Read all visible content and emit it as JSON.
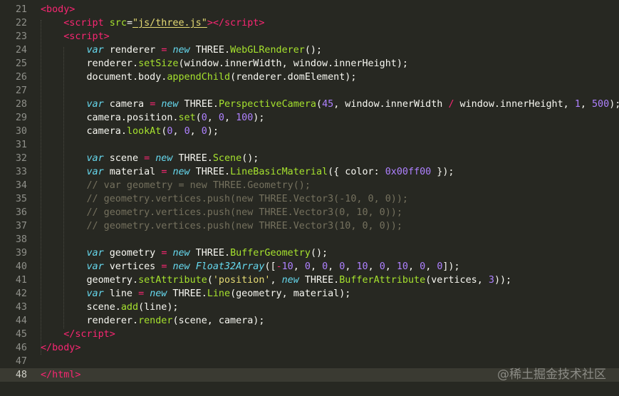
{
  "editor": {
    "theme": "Monokai",
    "colors": {
      "background": "#272822",
      "current_line": "#3a3a32",
      "line_number": "#8f908a",
      "tag": "#f92672",
      "attribute": "#a6e22e",
      "string": "#e6db74",
      "keyword": "#66d9ef",
      "number": "#ae81ff",
      "comment": "#75715e",
      "text": "#f8f8f2"
    },
    "current_line_number": 48,
    "lines": [
      {
        "n": 21,
        "tokens": [
          [
            "tag",
            "<body>"
          ]
        ]
      },
      {
        "n": 22,
        "tokens": [
          [
            "text",
            "    "
          ],
          [
            "tag",
            "<script "
          ],
          [
            "attr",
            "src"
          ],
          [
            "text",
            "="
          ],
          [
            "str",
            "\"js/three.js\""
          ],
          [
            "tag",
            "></"
          ],
          [
            "tag",
            "script"
          ],
          [
            "tag",
            ">"
          ]
        ]
      },
      {
        "n": 23,
        "tokens": [
          [
            "text",
            "    "
          ],
          [
            "tag",
            "<script>"
          ]
        ]
      },
      {
        "n": 24,
        "tokens": [
          [
            "text",
            "        "
          ],
          [
            "kw",
            "var"
          ],
          [
            "text",
            " renderer "
          ],
          [
            "op",
            "="
          ],
          [
            "text",
            " "
          ],
          [
            "kw",
            "new"
          ],
          [
            "text",
            " THREE."
          ],
          [
            "fn",
            "WebGLRenderer"
          ],
          [
            "text",
            "();"
          ]
        ]
      },
      {
        "n": 25,
        "tokens": [
          [
            "text",
            "        renderer."
          ],
          [
            "fn",
            "setSize"
          ],
          [
            "text",
            "(window.innerWidth, window.innerHeight);"
          ]
        ]
      },
      {
        "n": 26,
        "tokens": [
          [
            "text",
            "        document.body."
          ],
          [
            "fn",
            "appendChild"
          ],
          [
            "text",
            "(renderer.domElement);"
          ]
        ]
      },
      {
        "n": 27,
        "tokens": []
      },
      {
        "n": 28,
        "tokens": [
          [
            "text",
            "        "
          ],
          [
            "kw",
            "var"
          ],
          [
            "text",
            " camera "
          ],
          [
            "op",
            "="
          ],
          [
            "text",
            " "
          ],
          [
            "kw",
            "new"
          ],
          [
            "text",
            " THREE."
          ],
          [
            "fn",
            "PerspectiveCamera"
          ],
          [
            "text",
            "("
          ],
          [
            "num",
            "45"
          ],
          [
            "text",
            ", window.innerWidth "
          ],
          [
            "op",
            "/"
          ],
          [
            "text",
            " window.innerHeight, "
          ],
          [
            "num",
            "1"
          ],
          [
            "text",
            ", "
          ],
          [
            "num",
            "500"
          ],
          [
            "text",
            ");"
          ]
        ]
      },
      {
        "n": 29,
        "tokens": [
          [
            "text",
            "        camera.position."
          ],
          [
            "fn",
            "set"
          ],
          [
            "text",
            "("
          ],
          [
            "num",
            "0"
          ],
          [
            "text",
            ", "
          ],
          [
            "num",
            "0"
          ],
          [
            "text",
            ", "
          ],
          [
            "num",
            "100"
          ],
          [
            "text",
            ");"
          ]
        ]
      },
      {
        "n": 30,
        "tokens": [
          [
            "text",
            "        camera."
          ],
          [
            "fn",
            "lookAt"
          ],
          [
            "text",
            "("
          ],
          [
            "num",
            "0"
          ],
          [
            "text",
            ", "
          ],
          [
            "num",
            "0"
          ],
          [
            "text",
            ", "
          ],
          [
            "num",
            "0"
          ],
          [
            "text",
            ");"
          ]
        ]
      },
      {
        "n": 31,
        "tokens": []
      },
      {
        "n": 32,
        "tokens": [
          [
            "text",
            "        "
          ],
          [
            "kw",
            "var"
          ],
          [
            "text",
            " scene "
          ],
          [
            "op",
            "="
          ],
          [
            "text",
            " "
          ],
          [
            "kw",
            "new"
          ],
          [
            "text",
            " THREE."
          ],
          [
            "fn",
            "Scene"
          ],
          [
            "text",
            "();"
          ]
        ]
      },
      {
        "n": 33,
        "tokens": [
          [
            "text",
            "        "
          ],
          [
            "kw",
            "var"
          ],
          [
            "text",
            " material "
          ],
          [
            "op",
            "="
          ],
          [
            "text",
            " "
          ],
          [
            "kw",
            "new"
          ],
          [
            "text",
            " THREE."
          ],
          [
            "fn",
            "LineBasicMaterial"
          ],
          [
            "text",
            "({ color: "
          ],
          [
            "num",
            "0x00ff00"
          ],
          [
            "text",
            " });"
          ]
        ]
      },
      {
        "n": 34,
        "tokens": [
          [
            "text",
            "        "
          ],
          [
            "cmt",
            "// var geometry = new THREE.Geometry();"
          ]
        ]
      },
      {
        "n": 35,
        "tokens": [
          [
            "text",
            "        "
          ],
          [
            "cmt",
            "// geometry.vertices.push(new THREE.Vector3(-10, 0, 0));"
          ]
        ]
      },
      {
        "n": 36,
        "tokens": [
          [
            "text",
            "        "
          ],
          [
            "cmt",
            "// geometry.vertices.push(new THREE.Vector3(0, 10, 0));"
          ]
        ]
      },
      {
        "n": 37,
        "tokens": [
          [
            "text",
            "        "
          ],
          [
            "cmt",
            "// geometry.vertices.push(new THREE.Vector3(10, 0, 0));"
          ]
        ]
      },
      {
        "n": 38,
        "tokens": []
      },
      {
        "n": 39,
        "tokens": [
          [
            "text",
            "        "
          ],
          [
            "kw",
            "var"
          ],
          [
            "text",
            " geometry "
          ],
          [
            "op",
            "="
          ],
          [
            "text",
            " "
          ],
          [
            "kw",
            "new"
          ],
          [
            "text",
            " THREE."
          ],
          [
            "fn",
            "BufferGeometry"
          ],
          [
            "text",
            "();"
          ]
        ]
      },
      {
        "n": 40,
        "tokens": [
          [
            "text",
            "        "
          ],
          [
            "kw",
            "var"
          ],
          [
            "text",
            " vertices "
          ],
          [
            "op",
            "="
          ],
          [
            "text",
            " "
          ],
          [
            "kw",
            "new"
          ],
          [
            "text",
            " "
          ],
          [
            "type",
            "Float32Array"
          ],
          [
            "text",
            "(["
          ],
          [
            "op",
            "-"
          ],
          [
            "num",
            "10"
          ],
          [
            "text",
            ", "
          ],
          [
            "num",
            "0"
          ],
          [
            "text",
            ", "
          ],
          [
            "num",
            "0"
          ],
          [
            "text",
            ", "
          ],
          [
            "num",
            "0"
          ],
          [
            "text",
            ", "
          ],
          [
            "num",
            "10"
          ],
          [
            "text",
            ", "
          ],
          [
            "num",
            "0"
          ],
          [
            "text",
            ", "
          ],
          [
            "num",
            "10"
          ],
          [
            "text",
            ", "
          ],
          [
            "num",
            "0"
          ],
          [
            "text",
            ", "
          ],
          [
            "num",
            "0"
          ],
          [
            "text",
            "]);"
          ]
        ]
      },
      {
        "n": 41,
        "tokens": [
          [
            "text",
            "        geometry."
          ],
          [
            "fn",
            "setAttribute"
          ],
          [
            "text",
            "("
          ],
          [
            "str2",
            "'position'"
          ],
          [
            "text",
            ", "
          ],
          [
            "kw",
            "new"
          ],
          [
            "text",
            " THREE."
          ],
          [
            "fn",
            "BufferAttribute"
          ],
          [
            "text",
            "(vertices, "
          ],
          [
            "num",
            "3"
          ],
          [
            "text",
            "));"
          ]
        ]
      },
      {
        "n": 42,
        "tokens": [
          [
            "text",
            "        "
          ],
          [
            "kw",
            "var"
          ],
          [
            "text",
            " line "
          ],
          [
            "op",
            "="
          ],
          [
            "text",
            " "
          ],
          [
            "kw",
            "new"
          ],
          [
            "text",
            " THREE."
          ],
          [
            "fn",
            "Line"
          ],
          [
            "text",
            "(geometry, material);"
          ]
        ]
      },
      {
        "n": 43,
        "tokens": [
          [
            "text",
            "        scene."
          ],
          [
            "fn",
            "add"
          ],
          [
            "text",
            "(line);"
          ]
        ]
      },
      {
        "n": 44,
        "tokens": [
          [
            "text",
            "        renderer."
          ],
          [
            "fn",
            "render"
          ],
          [
            "text",
            "(scene, camera);"
          ]
        ]
      },
      {
        "n": 45,
        "tokens": [
          [
            "text",
            "    "
          ],
          [
            "tag",
            "</"
          ],
          [
            "tag",
            "script"
          ],
          [
            "tag",
            ">"
          ]
        ]
      },
      {
        "n": 46,
        "tokens": [
          [
            "tag",
            "</body>"
          ]
        ]
      },
      {
        "n": 47,
        "tokens": []
      },
      {
        "n": 48,
        "tokens": [
          [
            "tag",
            "</html>"
          ]
        ]
      }
    ]
  },
  "watermark": "@稀土掘金技术社区"
}
